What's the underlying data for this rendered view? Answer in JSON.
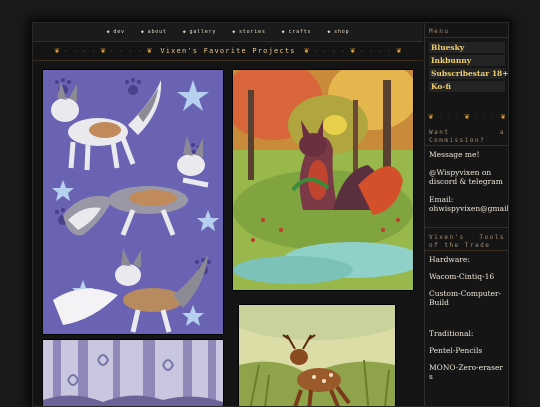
{
  "nav": {
    "items": [
      {
        "label": "dev"
      },
      {
        "label": "about"
      },
      {
        "label": "gallery"
      },
      {
        "label": "stories"
      },
      {
        "label": "crafts"
      },
      {
        "label": "shop"
      }
    ]
  },
  "header": {
    "title": "Vixen's Favorite Projects"
  },
  "gallery": {
    "items": [
      {
        "name": "wolf-ref-sheet"
      },
      {
        "name": "dragon-foxes-scene"
      },
      {
        "name": "forest-strip"
      },
      {
        "name": "deer-fawn-art"
      }
    ]
  },
  "sidebar": {
    "menu_heading": "Menu",
    "links": [
      {
        "label": "Bluesky"
      },
      {
        "label": "Inkbunny"
      },
      {
        "label": "Subscribestar 18+"
      },
      {
        "label": "Ko-fi"
      }
    ],
    "commission_heading": "Want a Commission?",
    "commission_text": "Message me!",
    "commission_handle": "@Wispyvixen on discord & telegram",
    "email_label": "Email:",
    "email_value": "ohwispyvixen@gmail.com",
    "tools_heading": "Vixen's Tools of the Trade",
    "hardware_label": "Hardware:",
    "hardware_items": [
      "Wacom-Cintiq-16",
      "Custom-Computer-Build"
    ],
    "traditional_label": "Traditional:",
    "traditional_items": [
      "Pentel-Pencils",
      "MONO-Zero-erasers"
    ]
  },
  "colors": {
    "background": "#141414",
    "accent": "#f0d070",
    "text": "#efe6d8",
    "muted": "#a58f73"
  }
}
